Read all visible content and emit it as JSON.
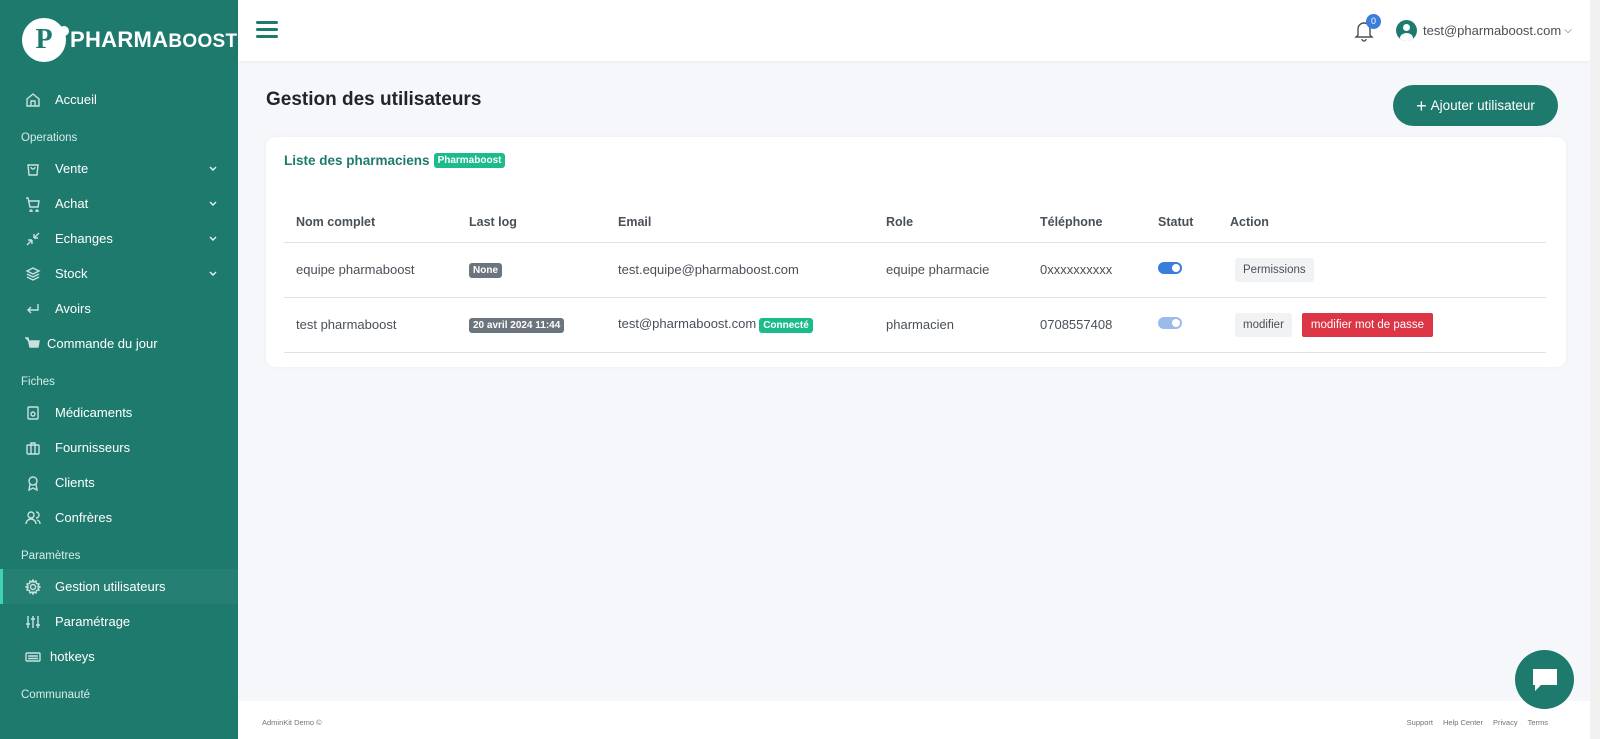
{
  "brand": {
    "letter": "P",
    "name_part1": "Pharma",
    "name_part2": "Boost"
  },
  "sidebar": {
    "home": "Accueil",
    "section_operations": "Operations",
    "operations": [
      {
        "label": "Vente",
        "icon": "bag-icon",
        "has_chevron": true
      },
      {
        "label": "Achat",
        "icon": "cart-icon",
        "has_chevron": true
      },
      {
        "label": "Echanges",
        "icon": "minimize-icon",
        "has_chevron": true
      },
      {
        "label": "Stock",
        "icon": "layers-icon",
        "has_chevron": true
      },
      {
        "label": "Avoirs",
        "icon": "corner-down-left-icon",
        "has_chevron": false
      },
      {
        "label": "Commande du jour",
        "icon": "cart-filled-icon",
        "has_chevron": false
      }
    ],
    "section_fiches": "Fiches",
    "fiches": [
      {
        "label": "Médicaments",
        "icon": "speaker-icon"
      },
      {
        "label": "Fournisseurs",
        "icon": "briefcase-icon"
      },
      {
        "label": "Clients",
        "icon": "award-icon"
      },
      {
        "label": "Confrères",
        "icon": "users-icon"
      }
    ],
    "section_parametres": "Paramètres",
    "parametres": [
      {
        "label": "Gestion utilisateurs",
        "icon": "settings-icon",
        "active": true
      },
      {
        "label": "Paramétrage",
        "icon": "sliders-icon"
      },
      {
        "label": "hotkeys",
        "icon": "keyboard-icon"
      }
    ],
    "section_communaute": "Communauté"
  },
  "topbar": {
    "notifications_count": "0",
    "user_email": "test@pharmaboost.com",
    "user_chevron": "⌵"
  },
  "main": {
    "title_bold": "Gestion",
    "title_rest": " des utilisateurs",
    "add_button_plus": "+",
    "add_button_label": "Ajouter utilisateur",
    "card_title": "Liste des pharmaciens",
    "card_badge": "Pharmaboost",
    "table": {
      "headers": [
        "Nom complet",
        "Last log",
        "Email",
        "Role",
        "Téléphone",
        "Statut",
        "Action"
      ],
      "rows": [
        {
          "name": "equipe pharmaboost",
          "last_log": "None",
          "email": "test.equipe@pharmaboost.com",
          "email_badge": "",
          "role": "equipe pharmacie",
          "phone": "0xxxxxxxxxx",
          "status_on": true,
          "actions": [
            "Permissions"
          ]
        },
        {
          "name": "test pharmaboost",
          "last_log": "20 avril 2024 11:44",
          "email": "test@pharmaboost.com",
          "email_badge": "Connecté",
          "role": "pharmacien",
          "phone": "0708557408",
          "status_on": true,
          "actions": [
            "modifier",
            "modifier mot de passe"
          ]
        }
      ]
    }
  },
  "footer": {
    "left": "AdminKit Demo ©",
    "links": [
      "Support",
      "Help Center",
      "Privacy",
      "Terms"
    ]
  },
  "colors": {
    "primary": "#1f7a6e",
    "accent": "#3fd3b5",
    "success": "#1cbb8c",
    "danger": "#dc3545",
    "info": "#3b7ddd"
  }
}
